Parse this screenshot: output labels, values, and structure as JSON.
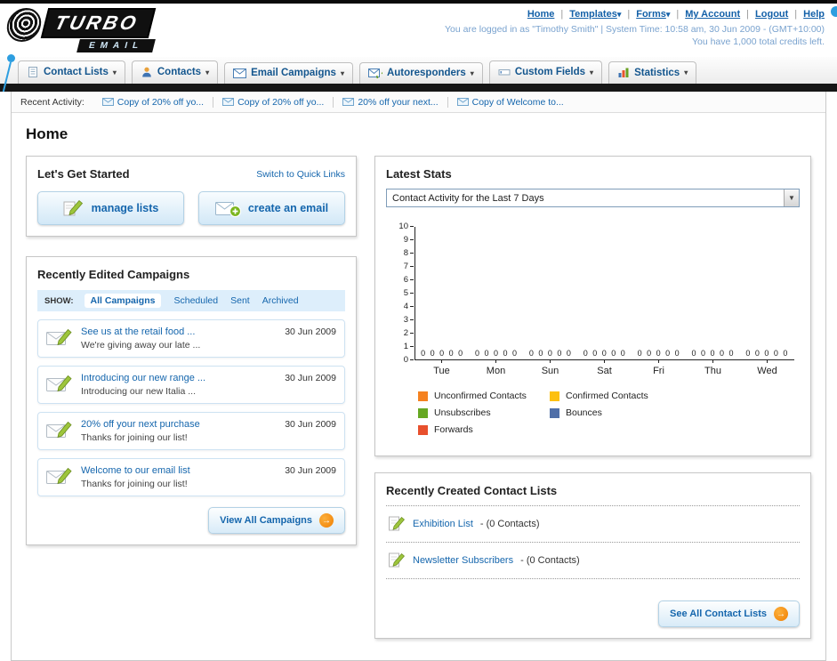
{
  "header": {
    "logo": {
      "title": "TURBO",
      "subtitle": "EMAIL"
    },
    "links": [
      {
        "label": "Home",
        "dropdown": false
      },
      {
        "label": "Templates",
        "dropdown": true
      },
      {
        "label": "Forms",
        "dropdown": true
      },
      {
        "label": "My Account",
        "dropdown": false
      },
      {
        "label": "Logout",
        "dropdown": false
      },
      {
        "label": "Help",
        "dropdown": false
      }
    ],
    "login_info": "You are logged in as \"Timothy Smith\" | System Time: 10:58 am, 30 Jun 2009 - (GMT+10:00)",
    "credits_info": "You have 1,000 total credits left."
  },
  "nav": {
    "items": [
      {
        "label": "Contact Lists",
        "icon": "contact-lists-icon"
      },
      {
        "label": "Contacts",
        "icon": "contacts-icon"
      },
      {
        "label": "Email Campaigns",
        "icon": "email-campaigns-icon"
      },
      {
        "label": "Autoresponders",
        "icon": "autoresponders-icon"
      },
      {
        "label": "Custom Fields",
        "icon": "custom-fields-icon"
      },
      {
        "label": "Statistics",
        "icon": "statistics-icon"
      }
    ]
  },
  "recent_activity": {
    "label": "Recent Activity:",
    "items": [
      "Copy of 20% off yo...",
      "Copy of 20% off yo...",
      "20% off your next...",
      "Copy of Welcome to..."
    ]
  },
  "page": {
    "title": "Home"
  },
  "get_started": {
    "title": "Let's Get Started",
    "switch_link": "Switch to Quick Links",
    "buttons": [
      {
        "label": "manage lists",
        "icon": "pencil-icon"
      },
      {
        "label": "create an email",
        "icon": "envelope-plus-icon"
      }
    ]
  },
  "campaigns": {
    "title": "Recently Edited Campaigns",
    "show_label": "SHOW:",
    "filters": [
      {
        "label": "All Campaigns",
        "active": true
      },
      {
        "label": "Scheduled",
        "active": false
      },
      {
        "label": "Sent",
        "active": false
      },
      {
        "label": "Archived",
        "active": false
      }
    ],
    "items": [
      {
        "title": "See us at the retail food ...",
        "subtitle": "We're giving away our late ...",
        "date": "30 Jun 2009"
      },
      {
        "title": "Introducing our new range ...",
        "subtitle": "Introducing our new Italia ...",
        "date": "30 Jun 2009"
      },
      {
        "title": "20% off your next purchase",
        "subtitle": "Thanks for joining our list!",
        "date": "30 Jun 2009"
      },
      {
        "title": "Welcome to our email list",
        "subtitle": "Thanks for joining our list!",
        "date": "30 Jun 2009"
      }
    ],
    "view_all_label": "View All Campaigns"
  },
  "stats": {
    "title": "Latest Stats",
    "dropdown_value": "Contact Activity for the Last 7 Days",
    "chart_data": {
      "type": "bar",
      "title": "Contact Activity for the Last 7 Days",
      "categories": [
        "Tue",
        "Mon",
        "Sun",
        "Sat",
        "Fri",
        "Thu",
        "Wed"
      ],
      "series": [
        {
          "name": "Unconfirmed Contacts",
          "color": "#f58220",
          "values": [
            0,
            0,
            0,
            0,
            0,
            0,
            0
          ]
        },
        {
          "name": "Confirmed Contacts",
          "color": "#fdc010",
          "values": [
            0,
            0,
            0,
            0,
            0,
            0,
            0
          ]
        },
        {
          "name": "Unsubscribes",
          "color": "#66a822",
          "values": [
            0,
            0,
            0,
            0,
            0,
            0,
            0
          ]
        },
        {
          "name": "Bounces",
          "color": "#4f6fa8",
          "values": [
            0,
            0,
            0,
            0,
            0,
            0,
            0
          ]
        },
        {
          "name": "Forwards",
          "color": "#e8502d",
          "values": [
            0,
            0,
            0,
            0,
            0,
            0,
            0
          ]
        }
      ],
      "xlabel": "",
      "ylabel": "",
      "ylim": [
        0,
        10
      ],
      "yticks": [
        0,
        1,
        2,
        3,
        4,
        5,
        6,
        7,
        8,
        9,
        10
      ],
      "grid": false,
      "legend_position": "bottom"
    }
  },
  "contact_lists": {
    "title": "Recently Created Contact Lists",
    "items": [
      {
        "name": "Exhibition List",
        "detail": "- (0 Contacts)"
      },
      {
        "name": "Newsletter Subscribers",
        "detail": "- (0 Contacts)"
      }
    ],
    "see_all_label": "See All Contact Lists"
  },
  "colors": {
    "link_blue": "#1566ad",
    "accent_orange": "#f07d00",
    "logo_bubble_blue": "#2d9ee0",
    "filter_bar_blue": "#ddeefb"
  }
}
